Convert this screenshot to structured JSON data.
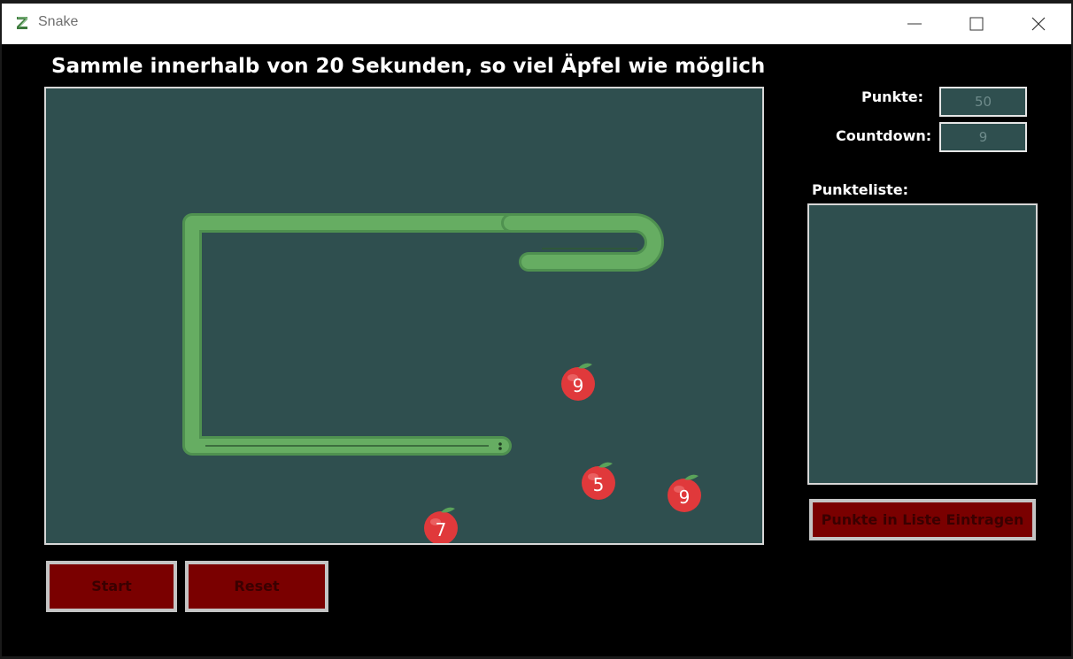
{
  "window": {
    "title": "Snake"
  },
  "game": {
    "instruction": "Sammle innerhalb von 20 Sekunden, so viel Äpfel wie möglich",
    "apples": [
      {
        "value": "9"
      },
      {
        "value": "5"
      },
      {
        "value": "9"
      },
      {
        "value": "7"
      }
    ]
  },
  "score_panel": {
    "punkte_label": "Punkte:",
    "punkte_value": "50",
    "countdown_label": "Countdown:",
    "countdown_value": "9",
    "list_label": "Punkteliste:",
    "list_items": [],
    "add_button_label": "Punkte in Liste Eintragen"
  },
  "controls": {
    "start_label": "Start",
    "reset_label": "Reset"
  },
  "colors": {
    "board": "#2f4f4f",
    "snake": "#5fa35f",
    "button": "#7a0000",
    "apple": "#e0393b"
  },
  "icons": {
    "app": "snake-app-icon",
    "minimize": "minimize-icon",
    "maximize": "maximize-icon",
    "close": "close-icon",
    "apple": "apple-icon"
  }
}
